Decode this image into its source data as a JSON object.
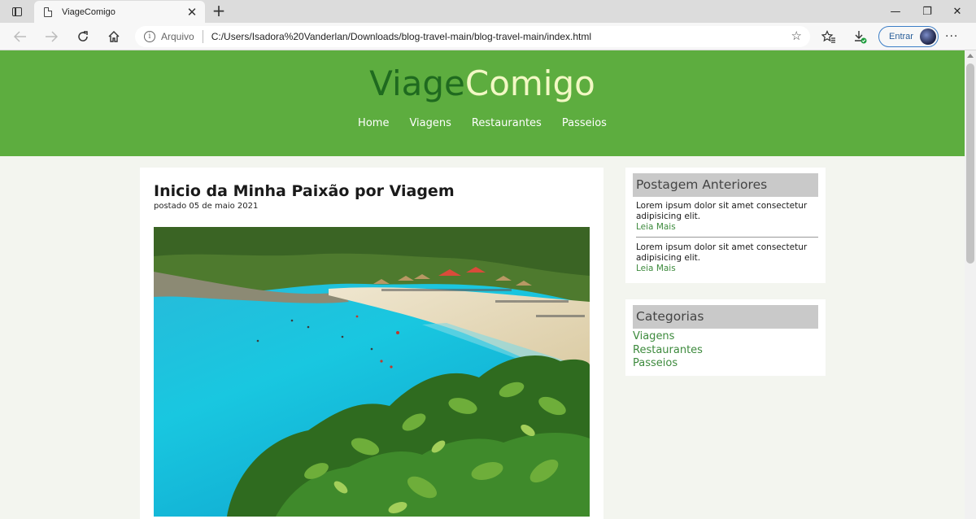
{
  "browser": {
    "tab_title": "ViageComigo",
    "tab_close": "✕",
    "new_tab": "+",
    "address_origin": "Arquivo",
    "address_url": "C:/Users/Isadora%20Vanderlan/Downloads/blog-travel-main/blog-travel-main/index.html",
    "signin_label": "Entrar",
    "more_label": "···",
    "minimize": "—",
    "restore": "❐",
    "close": "✕"
  },
  "site": {
    "logo_part1": "Viage",
    "logo_part2": "Comigo",
    "nav": [
      "Home",
      "Viagens",
      "Restaurantes",
      "Passeios"
    ]
  },
  "post": {
    "title": "Inicio da Minha Paixão por Viagem",
    "date": "postado 05 de maio 2021"
  },
  "sidebar": {
    "previous": {
      "title": "Postagem Anteriores",
      "items": [
        {
          "text": "Lorem ipsum dolor sit amet consectetur adipisicing elit.",
          "link": "Leia Mais"
        },
        {
          "text": "Lorem ipsum dolor sit amet consectetur adipisicing elit.",
          "link": "Leia Mais"
        }
      ]
    },
    "categories": {
      "title": "Categorias",
      "items": [
        "Viagens",
        "Restaurantes",
        "Passeios"
      ]
    }
  },
  "colors": {
    "header_green": "#5dad3f",
    "logo_dark": "#1f6a1f",
    "logo_light": "#f2f8c4",
    "link_green": "#3d8a3d"
  }
}
